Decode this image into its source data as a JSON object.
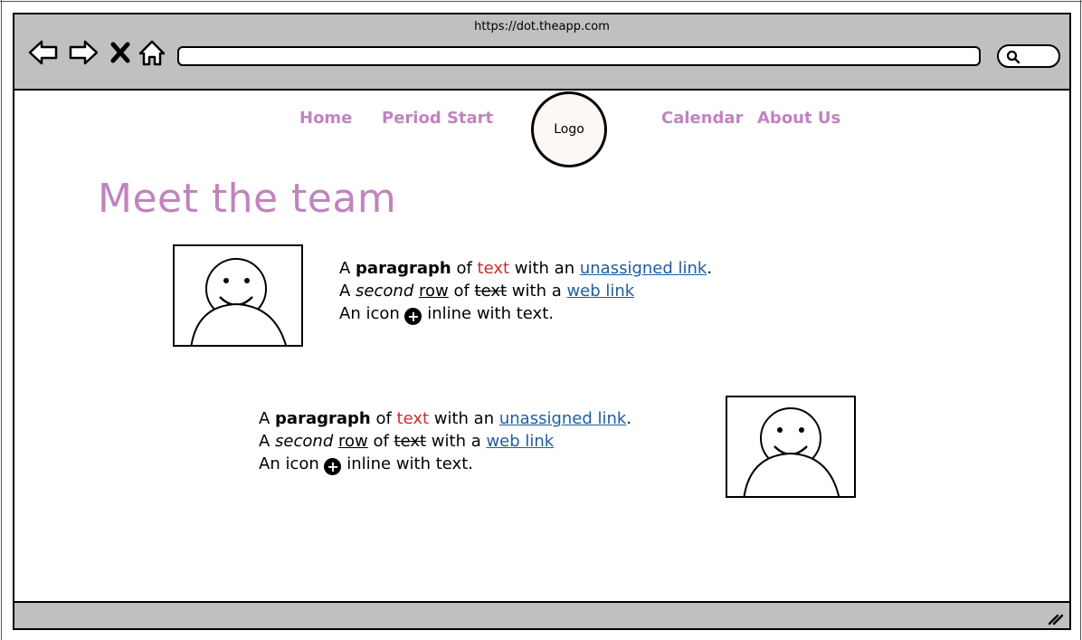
{
  "browser": {
    "url": "https://dot.theapp.com",
    "icons": [
      "back-arrow-icon",
      "forward-arrow-icon",
      "stop-x-icon",
      "home-icon",
      "search-icon",
      "resize-grip-icon"
    ]
  },
  "nav": {
    "home": "Home",
    "period_start": "Period Start",
    "logo": "Logo",
    "calendar": "Calendar",
    "about": "About Us"
  },
  "page": {
    "title": "Meet the team"
  },
  "members": [
    {
      "line1": {
        "a": "A ",
        "bold": "paragraph",
        "of": " of ",
        "red": "text",
        "with": " with an ",
        "link": "unassigned link",
        "end": "."
      },
      "line2": {
        "a": "A ",
        "italic": "second",
        "sp": " ",
        "underline": "row",
        "of": " of ",
        "strike": "text",
        "with": " with a ",
        "link": "web link"
      },
      "line3": {
        "start": "An icon ",
        "icon": "+",
        "end": " inline with text."
      }
    },
    {
      "line1": {
        "a": "A ",
        "bold": "paragraph",
        "of": " of ",
        "red": "text",
        "with": " with an ",
        "link": "unassigned link",
        "end": "."
      },
      "line2": {
        "a": "A ",
        "italic": "second",
        "sp": " ",
        "underline": "row",
        "of": " of ",
        "strike": "text",
        "with": " with a ",
        "link": "web link"
      },
      "line3": {
        "start": "An icon ",
        "icon": "+",
        "end": " inline with text."
      }
    }
  ],
  "colors": {
    "accent": "#c084bf",
    "link": "#1f5da0",
    "red_text": "#d12b2b",
    "chrome": "#c0c0c0"
  }
}
